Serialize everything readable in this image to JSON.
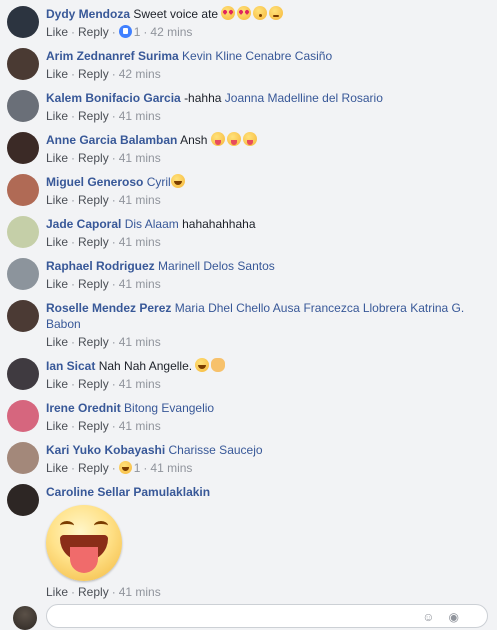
{
  "comments": [
    {
      "author": "Dydy Mendoza",
      "text": "Sweet voice ate",
      "emojis": [
        "heart-eyes",
        "heart-eyes",
        "kiss",
        "smirk"
      ],
      "like": "Like",
      "reply": "Reply",
      "reaction": {
        "type": "like",
        "count": "1"
      },
      "time": "42 mins",
      "avatar": "#2c3440"
    },
    {
      "author": "Arim Zednanref Surima",
      "mentions": "Kevin Kline Cenabre Casiño",
      "like": "Like",
      "reply": "Reply",
      "time": "42 mins",
      "avatar": "#4a3a33"
    },
    {
      "author": "Kalem Bonifacio Garcia",
      "text": "-hahha",
      "mentions": "Joanna Madelline del Rosario",
      "like": "Like",
      "reply": "Reply",
      "time": "41 mins",
      "avatar": "#6a6f78"
    },
    {
      "author": "Anne Garcia Balamban",
      "text": "Ansh",
      "emojis": [
        "tongue",
        "tongue",
        "tongue"
      ],
      "like": "Like",
      "reply": "Reply",
      "time": "41 mins",
      "avatar": "#3b2a26"
    },
    {
      "author": "Miguel Generoso",
      "mentions": "Cyril",
      "emojis": [
        "laugh"
      ],
      "like": "Like",
      "reply": "Reply",
      "time": "41 mins",
      "avatar": "#b06a55"
    },
    {
      "author": "Jade Caporal",
      "mentions": "Dis Alaam",
      "text": "hahahahhaha",
      "like": "Like",
      "reply": "Reply",
      "time": "41 mins",
      "avatar": "#c5cfa8"
    },
    {
      "author": "Raphael Rodriguez",
      "mentions": "Marinell Delos Santos",
      "like": "Like",
      "reply": "Reply",
      "time": "41 mins",
      "avatar": "#8c949c"
    },
    {
      "author": "Roselle Mendez Perez",
      "mentions": "Maria Dhel Chello Ausa Francezca Llobrera",
      "mentions2": "Katrina G. Babon",
      "like": "Like",
      "reply": "Reply",
      "time": "41 mins",
      "avatar": "#4b3a34"
    },
    {
      "author": "Ian Sicat",
      "text": "Nah Nah Angelle.",
      "emojis": [
        "laugh",
        "ok"
      ],
      "like": "Like",
      "reply": "Reply",
      "time": "41 mins",
      "avatar": "#3f3a40"
    },
    {
      "author": "Irene Orednit",
      "mentions": "Bitong Evangelio",
      "like": "Like",
      "reply": "Reply",
      "time": "41 mins",
      "avatar": "#d6667e"
    },
    {
      "author": "Kari Yuko Kobayashi",
      "mentions": "Charisse Saucejo",
      "like": "Like",
      "reply": "Reply",
      "reaction": {
        "type": "haha",
        "count": "1"
      },
      "time": "41 mins",
      "avatar": "#a3887a"
    },
    {
      "author": "Caroline Sellar Pamulaklakin",
      "sticker": "tongue-out-sticker",
      "like": "Like",
      "reply": "Reply",
      "time": "41 mins",
      "avatar": "#2d2624"
    }
  ],
  "separator": "·",
  "colors": {
    "name": "#385898",
    "meta": "#90949c",
    "background": "#f2f3f5"
  }
}
